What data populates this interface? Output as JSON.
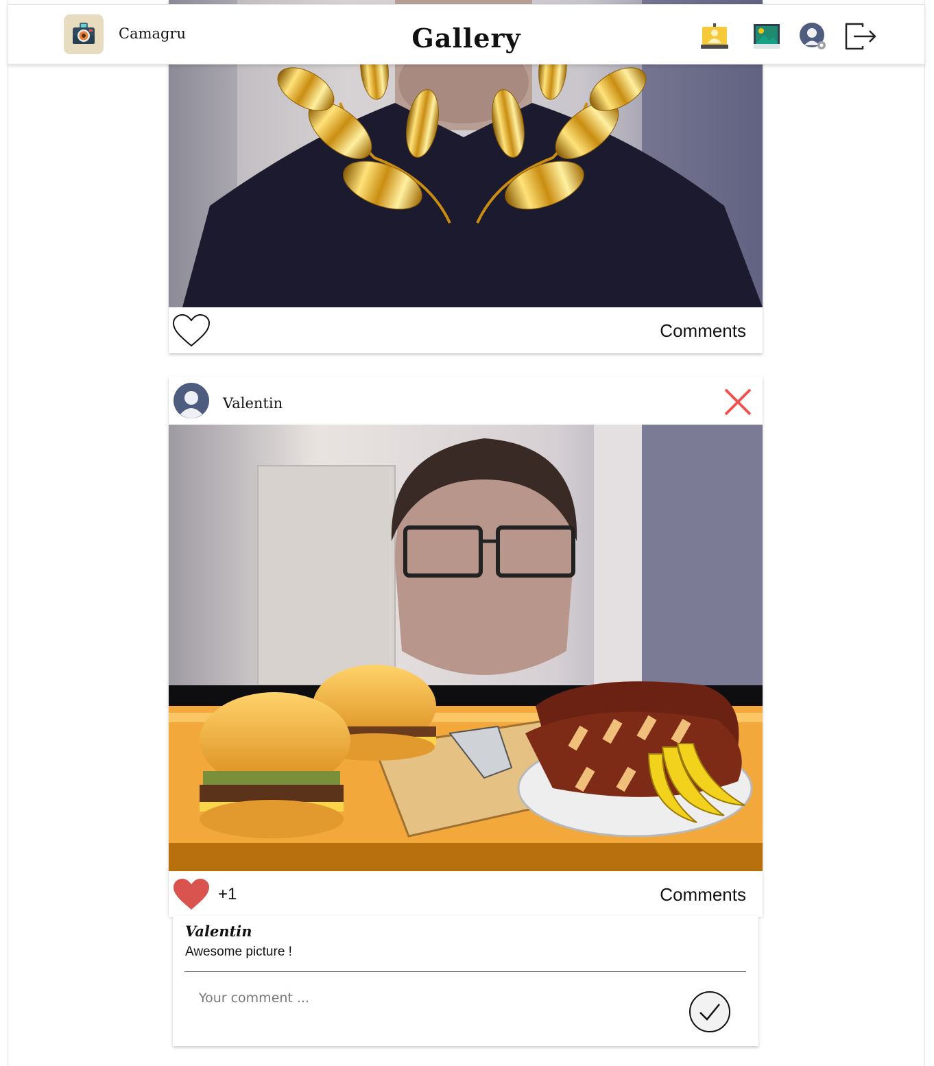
{
  "header": {
    "brand": "Camagru",
    "title": "Gallery",
    "nav": [
      {
        "name": "webcam-capture-icon"
      },
      {
        "name": "gallery-icon"
      },
      {
        "name": "account-settings-icon"
      },
      {
        "name": "logout-icon"
      }
    ]
  },
  "posts": [
    {
      "author": "",
      "liked": false,
      "likes": "",
      "comments_label": "Comments",
      "photo": "webcam selfie with golden laurel wreath sticker"
    },
    {
      "author": "Valentin",
      "liked": true,
      "likes": "+1",
      "comments_label": "Comments",
      "photo": "webcam selfie with food table sticker",
      "comments": [
        {
          "author": "Valentin",
          "text": "Awesome picture !"
        }
      ],
      "comment_placeholder": "Your comment ..."
    }
  ],
  "colors": {
    "like_red": "#d9534f",
    "delete_red": "#f0524d",
    "header_bg": "#ffffff"
  }
}
